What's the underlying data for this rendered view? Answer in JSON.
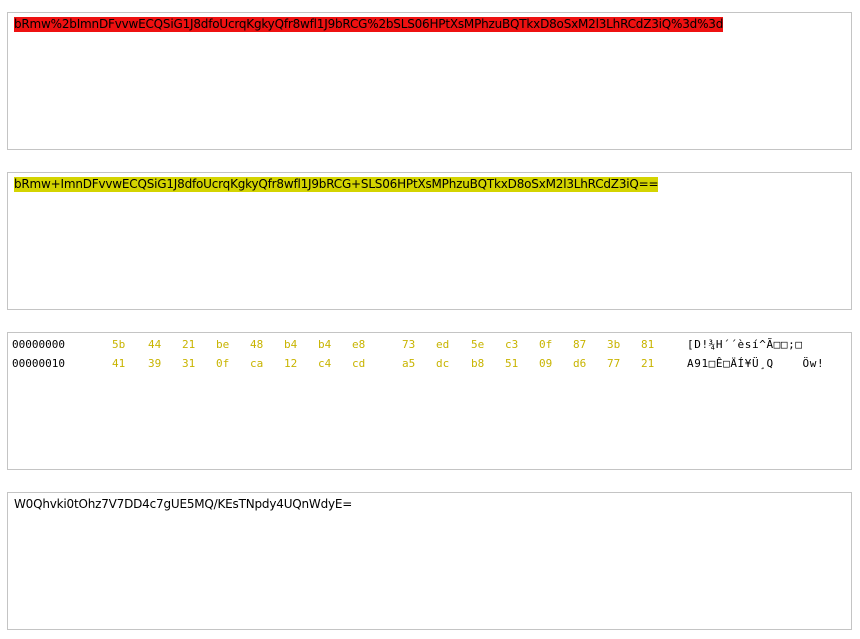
{
  "url_encoded": {
    "text": "bRmw%2bImnDFvvwECQSiG1J8dfoUcrqKgkyQfr8wfl1J9bRCG%2bSLS06HPtXsMPhzuBQTkxD8oSxM2l3LhRCdZ3iQ%3d%3d",
    "highlight_color": "#ee1111"
  },
  "base64": {
    "text": "bRmw+ImnDFvvwECQSiG1J8dfoUcrqKgkyQfr8wfl1J9bRCG+SLS06HPtXsMPhzuBQTkxD8oSxM2l3LhRCdZ3iQ==",
    "highlight_color": "#d4d400"
  },
  "hex_dump": {
    "byte_color": "#c8b400",
    "rows": [
      {
        "offset": "00000000",
        "bytes": [
          "5b",
          "44",
          "21",
          "be",
          "48",
          "b4",
          "b4",
          "e8",
          "73",
          "ed",
          "5e",
          "c3",
          "0f",
          "87",
          "3b",
          "81"
        ],
        "ascii": "[D!¾H´´èsí^Ã□□;□"
      },
      {
        "offset": "00000010",
        "bytes": [
          "41",
          "39",
          "31",
          "0f",
          "ca",
          "12",
          "c4",
          "cd",
          "a5",
          "dc",
          "b8",
          "51",
          "09",
          "d6",
          "77",
          "21"
        ],
        "ascii": "A91□Ê□ÄÍ¥Ü¸Q    Öw!"
      }
    ]
  },
  "output": {
    "text": "W0Qhvki0tOhz7V7DD4c7gUE5MQ/KEsTNpdy4UQnWdyE="
  }
}
